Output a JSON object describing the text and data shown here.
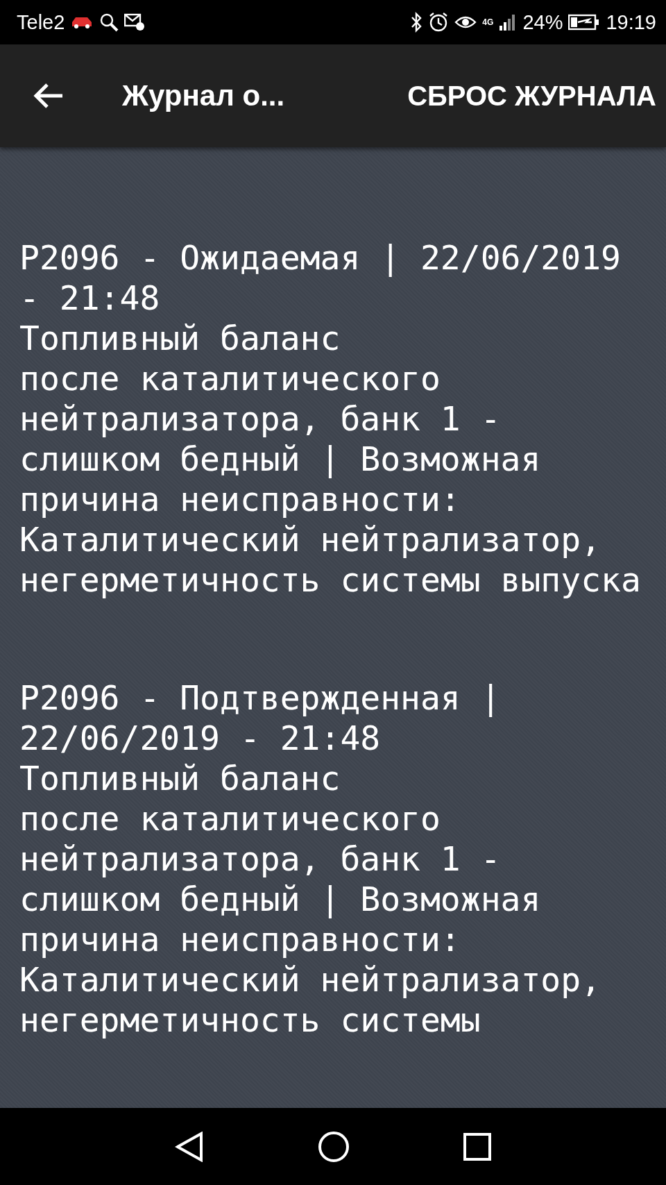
{
  "status_bar": {
    "carrier": "Tele2",
    "network": "4G",
    "battery": "24%",
    "time": "19:19"
  },
  "toolbar": {
    "title": "Журнал о...",
    "action": "СБРОС ЖУРНАЛА"
  },
  "entries": [
    {
      "header": "P2096 - Ожидаемая | 22/06/2019 - 21:48",
      "description": [
        "Топливный баланс",
        "после каталитического нейтрализатора, банк 1 - слишком бедный | Возможная причина неисправности: Каталитический нейтрализатор, негерметичность системы выпуска"
      ]
    },
    {
      "header": "P2096 - Подтвержденная | 22/06/2019 - 21:48",
      "description": [
        "Топливный баланс",
        "после каталитического нейтрализатора, банк 1 - слишком бедный | Возможная причина неисправности: Каталитический нейтрализатор, негерметичность системы"
      ]
    }
  ]
}
